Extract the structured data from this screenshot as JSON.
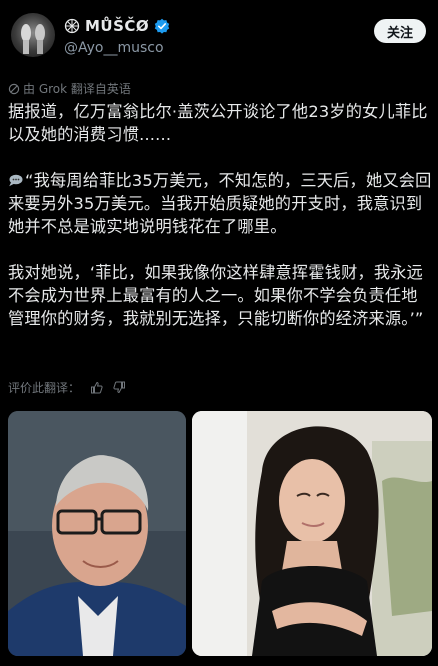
{
  "account": {
    "display_name": "MŮŠČØ",
    "handle": "@Ayo__musco",
    "follow_label": "关注"
  },
  "translation": {
    "note": "由 Grok 翻译自英语"
  },
  "post": {
    "paragraph_1": "据报道，亿万富翁比尔·盖茨公开谈论了他23岁的女儿菲比以及她的消费习惯......",
    "paragraph_2": "“我每周给菲比35万美元，不知怎的，三天后，她又会回来要另外35万美元。当我开始质疑她的开支时，我意识到她并不总是诚实地说明钱花在了哪里。",
    "paragraph_3": "我对她说，‘菲比，如果我像你这样肆意挥霍钱财，我永远不会成为世界上最富有的人之一。如果你不学会负责任地管理你的财务，我就别无选择，只能切断你的经济来源。’”"
  },
  "rating": {
    "label": "评价此翻译："
  },
  "icons": {
    "verified": "verified-badge-icon",
    "logo": "musco-logo-icon",
    "grok": "grok-icon",
    "speech": "speech-bubble-icon",
    "thumbs_up": "thumbs-up-icon",
    "thumbs_down": "thumbs-down-icon"
  },
  "colors": {
    "background": "#000000",
    "text": "#e7e9ea",
    "muted": "#71767b",
    "verified": "#1d9bf0",
    "follow_bg": "#eff3f4"
  }
}
